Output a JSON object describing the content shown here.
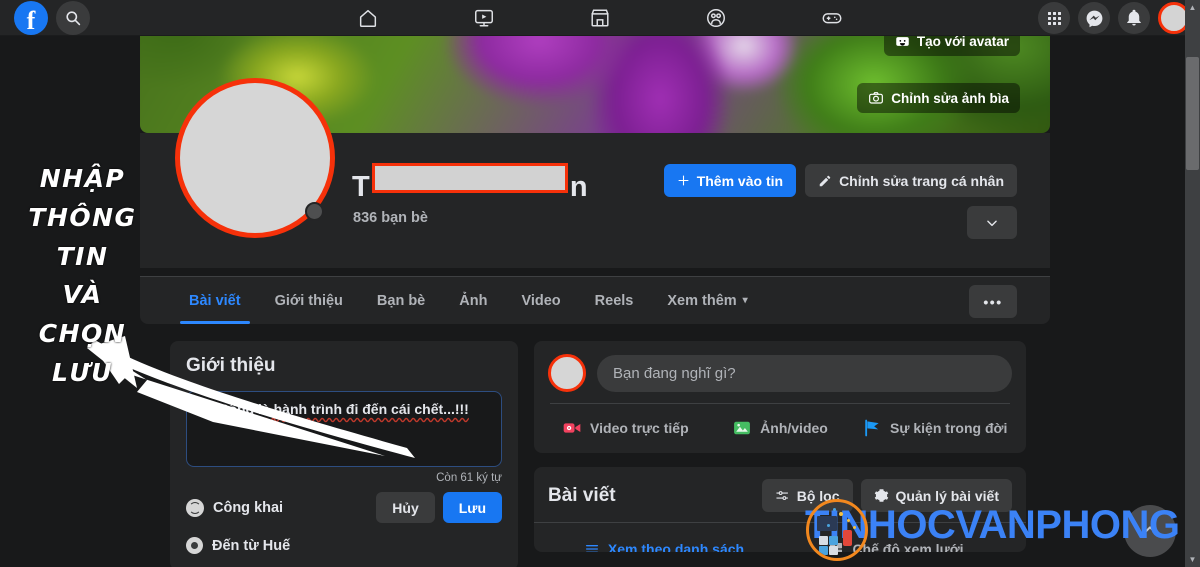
{
  "navbar": {
    "logo": "f",
    "search_icon": "search-icon",
    "tabs": [
      {
        "name": "home",
        "icon": "home-icon"
      },
      {
        "name": "watch",
        "icon": "video-icon"
      },
      {
        "name": "marketplace",
        "icon": "store-icon"
      },
      {
        "name": "groups",
        "icon": "groups-icon"
      },
      {
        "name": "gaming",
        "icon": "gamepad-icon"
      }
    ],
    "right": [
      {
        "name": "menu",
        "icon": "grid-icon"
      },
      {
        "name": "messenger",
        "icon": "messenger-icon"
      },
      {
        "name": "notifications",
        "icon": "bell-icon"
      },
      {
        "name": "account",
        "icon": "avatar-icon"
      }
    ]
  },
  "cover": {
    "create_avatar_label": "Tạo với avatar",
    "edit_cover_label": "Chỉnh sửa ảnh bìa"
  },
  "profile": {
    "name_prefix": "T",
    "name_suffix": "n",
    "name_redacted": true,
    "friends": "836 bạn bè",
    "add_story_label": "Thêm vào tin",
    "edit_profile_label": "Chỉnh sửa trang cá nhân",
    "more_label": "•••"
  },
  "tabs": [
    {
      "label": "Bài viết",
      "active": true
    },
    {
      "label": "Giới thiệu",
      "active": false
    },
    {
      "label": "Bạn bè",
      "active": false
    },
    {
      "label": "Ảnh",
      "active": false
    },
    {
      "label": "Video",
      "active": false
    },
    {
      "label": "Reels",
      "active": false
    },
    {
      "label": "Xem thêm",
      "active": false,
      "caret": "▾"
    }
  ],
  "intro_card": {
    "title": "Giới thiệu",
    "bio_value": "Sống là hành trình đi đến cái chết...!!!",
    "chars_left": "Còn 61 ký tự",
    "privacy_label": "Công khai",
    "cancel_label": "Hủy",
    "save_label": "Lưu",
    "from_label": "Đến từ Huế"
  },
  "composer": {
    "placeholder": "Bạn đang nghĩ gì?",
    "actions": [
      {
        "label": "Video trực tiếp",
        "icon": "live-video-icon",
        "color": "#f3425f"
      },
      {
        "label": "Ảnh/video",
        "icon": "photo-icon",
        "color": "#45bd62"
      },
      {
        "label": "Sự kiện trong đời",
        "icon": "flag-icon",
        "color": "#1b99f5"
      }
    ]
  },
  "posts_card": {
    "title": "Bài viết",
    "filter_label": "Bộ lọc",
    "manage_label": "Quản lý bài viết",
    "list_view_label": "Xem theo danh sách",
    "grid_view_label": "Chế độ xem lưới"
  },
  "annotation": {
    "lines": [
      "NHẬP",
      "THÔNG",
      "TIN",
      "VÀ",
      "CHỌN",
      "LƯU"
    ]
  },
  "watermark": {
    "text": "TINHOCVANPHONG",
    "color": "#3b82f6",
    "logo_ring_color": "#f2881e"
  },
  "colors": {
    "accent_blue": "#1877f2",
    "link_blue": "#2d88ff",
    "highlight_red": "#f6310a",
    "surface": "#242526",
    "background": "#18191a"
  }
}
